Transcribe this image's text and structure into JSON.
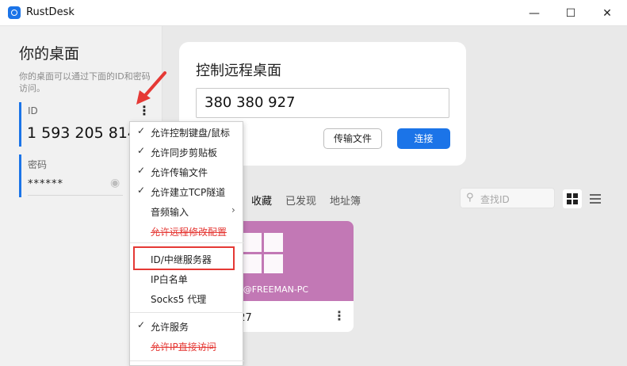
{
  "window": {
    "title": "RustDesk",
    "minimize_icon": "minimize-icon",
    "maximize_icon": "maximize-icon",
    "close_icon": "close-icon"
  },
  "left": {
    "title": "你的桌面",
    "description": "你的桌面可以通过下面的ID和密码访问。",
    "id_label": "ID",
    "id_value": "1 593 205 814",
    "password_label": "密码",
    "password_value": "******"
  },
  "remote": {
    "title": "控制远程桌面",
    "input_value": "380 380 927",
    "transfer_button": "传输文件",
    "connect_button": "连接"
  },
  "tabs": [
    {
      "label": "收藏",
      "active": true
    },
    {
      "label": "已发现",
      "active": false
    },
    {
      "label": "地址簿",
      "active": false
    }
  ],
  "search": {
    "placeholder": "查找ID"
  },
  "peer": {
    "user": "an@FREEMAN-PC",
    "id": "927"
  },
  "menu": {
    "items": [
      {
        "label": "允许控制键盘/鼠标",
        "checked": true
      },
      {
        "label": "允许同步剪贴板",
        "checked": true
      },
      {
        "label": "允许传输文件",
        "checked": true
      },
      {
        "label": "允许建立TCP隧道",
        "checked": true
      },
      {
        "label": "音频输入",
        "checked": false,
        "submenu": true
      },
      {
        "label": "允许远程修改配置",
        "checked": false,
        "strikethrough": true
      },
      {
        "label": "ID/中继服务器",
        "checked": false,
        "highlighted": true
      },
      {
        "label": "IP白名单",
        "checked": false
      },
      {
        "label": "Socks5 代理",
        "checked": false
      },
      {
        "label": "允许服务",
        "checked": true
      },
      {
        "label": "允许IP直接访问",
        "checked": false,
        "strikethrough": true
      }
    ]
  },
  "colors": {
    "accent": "#1b74e8",
    "peer_card": "#c278b5",
    "annotation_red": "#e53935"
  }
}
